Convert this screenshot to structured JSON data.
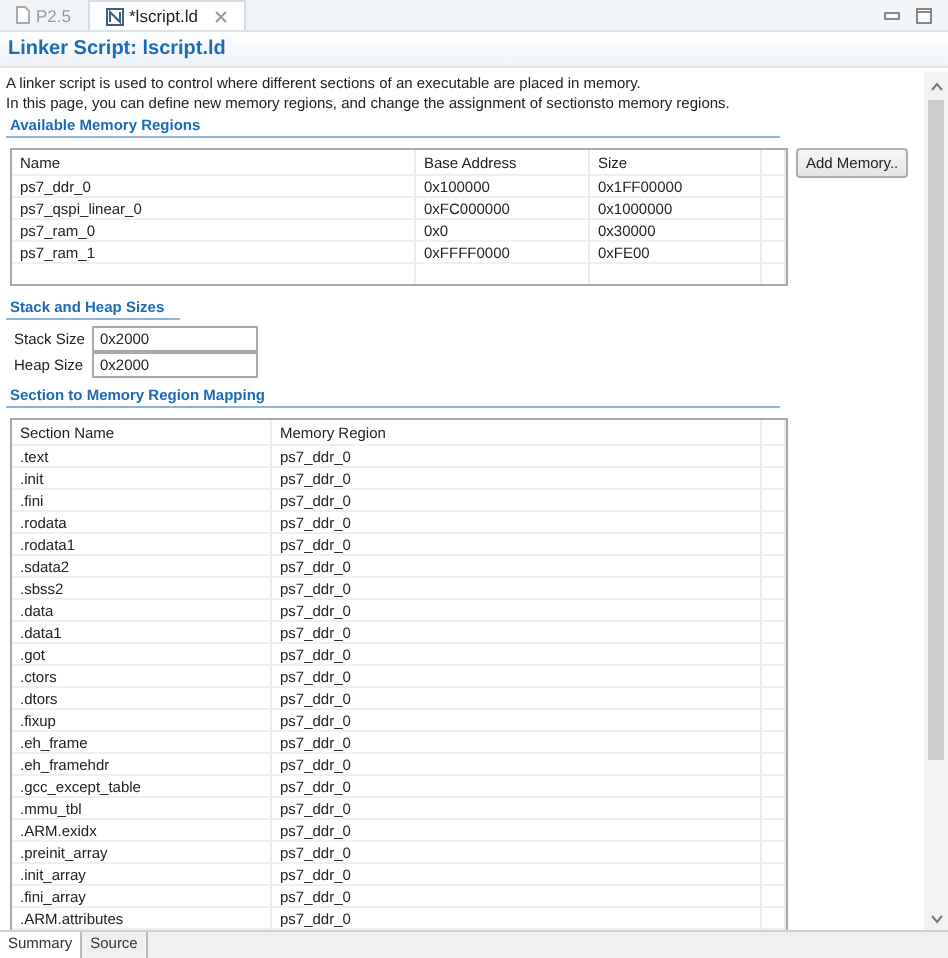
{
  "editor_tabs": [
    {
      "label": "P2.5",
      "selected": false
    },
    {
      "label": "*lscript.ld",
      "selected": true
    }
  ],
  "title": "Linker Script: lscript.ld",
  "description": [
    "A linker script is used to control where different sections of an executable are placed in memory.",
    "In this page, you can define new memory regions, and change the assignment of sectionsto memory regions."
  ],
  "memory_regions": {
    "heading": "Available Memory Regions",
    "columns": [
      "Name",
      "Base Address",
      "Size"
    ],
    "rows": [
      [
        "ps7_ddr_0",
        "0x100000",
        "0x1FF00000"
      ],
      [
        "ps7_qspi_linear_0",
        "0xFC000000",
        "0x1000000"
      ],
      [
        "ps7_ram_0",
        "0x0",
        "0x30000"
      ],
      [
        "ps7_ram_1",
        "0xFFFF0000",
        "0xFE00"
      ]
    ],
    "add_button": "Add Memory.."
  },
  "stack_heap": {
    "heading": "Stack and Heap Sizes",
    "fields": [
      {
        "label": "Stack Size",
        "value": "0x2000"
      },
      {
        "label": "Heap Size",
        "value": "0x2000"
      }
    ]
  },
  "section_mapping": {
    "heading": "Section to Memory Region Mapping",
    "columns": [
      "Section Name",
      "Memory Region"
    ],
    "rows": [
      [
        ".text",
        "ps7_ddr_0"
      ],
      [
        ".init",
        "ps7_ddr_0"
      ],
      [
        ".fini",
        "ps7_ddr_0"
      ],
      [
        ".rodata",
        "ps7_ddr_0"
      ],
      [
        ".rodata1",
        "ps7_ddr_0"
      ],
      [
        ".sdata2",
        "ps7_ddr_0"
      ],
      [
        ".sbss2",
        "ps7_ddr_0"
      ],
      [
        ".data",
        "ps7_ddr_0"
      ],
      [
        ".data1",
        "ps7_ddr_0"
      ],
      [
        ".got",
        "ps7_ddr_0"
      ],
      [
        ".ctors",
        "ps7_ddr_0"
      ],
      [
        ".dtors",
        "ps7_ddr_0"
      ],
      [
        ".fixup",
        "ps7_ddr_0"
      ],
      [
        ".eh_frame",
        "ps7_ddr_0"
      ],
      [
        ".eh_framehdr",
        "ps7_ddr_0"
      ],
      [
        ".gcc_except_table",
        "ps7_ddr_0"
      ],
      [
        ".mmu_tbl",
        "ps7_ddr_0"
      ],
      [
        ".ARM.exidx",
        "ps7_ddr_0"
      ],
      [
        ".preinit_array",
        "ps7_ddr_0"
      ],
      [
        ".init_array",
        "ps7_ddr_0"
      ],
      [
        ".fini_array",
        "ps7_ddr_0"
      ],
      [
        ".ARM.attributes",
        "ps7_ddr_0"
      ]
    ]
  },
  "bottom_tabs": [
    {
      "label": "Summary",
      "selected": true
    },
    {
      "label": "Source",
      "selected": false
    }
  ]
}
